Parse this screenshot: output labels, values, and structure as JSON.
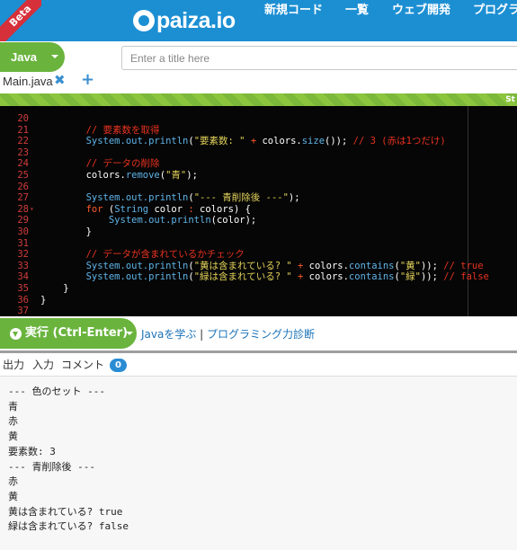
{
  "header": {
    "beta": "Beta",
    "logo_text": "paiza.io",
    "nav": [
      "新規コード",
      "一覧",
      "ウェブ開発",
      "プログラ"
    ]
  },
  "language": {
    "label": "Java"
  },
  "title_input": {
    "value": "",
    "placeholder": "Enter a title here"
  },
  "file_tab": {
    "label": "Main.java",
    "close": "✖",
    "add": "+"
  },
  "stripe_label": "St",
  "editor": {
    "lines": [
      {
        "n": "20",
        "fold": "",
        "tokens": []
      },
      {
        "n": "21",
        "fold": "",
        "tokens": [
          [
            "cm",
            "        // 要素数を取得"
          ]
        ]
      },
      {
        "n": "22",
        "fold": "",
        "tokens": [
          [
            "fld",
            "        System.out.println"
          ],
          [
            "txt",
            "("
          ],
          [
            "str",
            "\"要素数: \""
          ],
          [
            "txt",
            " "
          ],
          [
            "kw",
            "+"
          ],
          [
            "txt",
            " colors."
          ],
          [
            "mth",
            "size"
          ],
          [
            "txt",
            "()); "
          ],
          [
            "cm",
            "// 3 (赤は1つだけ)"
          ]
        ]
      },
      {
        "n": "23",
        "fold": "",
        "tokens": []
      },
      {
        "n": "24",
        "fold": "",
        "tokens": [
          [
            "cm",
            "        // データの削除"
          ]
        ]
      },
      {
        "n": "25",
        "fold": "",
        "tokens": [
          [
            "txt",
            "        colors."
          ],
          [
            "mth",
            "remove"
          ],
          [
            "txt",
            "("
          ],
          [
            "str",
            "\"青\""
          ],
          [
            "txt",
            ");"
          ]
        ]
      },
      {
        "n": "26",
        "fold": "",
        "tokens": []
      },
      {
        "n": "27",
        "fold": "",
        "tokens": [
          [
            "fld",
            "        System.out.println"
          ],
          [
            "txt",
            "("
          ],
          [
            "str",
            "\"--- 青削除後 ---\""
          ],
          [
            "txt",
            ");"
          ]
        ]
      },
      {
        "n": "28",
        "fold": "▾",
        "tokens": [
          [
            "kw",
            "        for"
          ],
          [
            "txt",
            " ("
          ],
          [
            "fld",
            "String"
          ],
          [
            "txt",
            " color "
          ],
          [
            "kw",
            ":"
          ],
          [
            "txt",
            " colors) {"
          ]
        ]
      },
      {
        "n": "29",
        "fold": "",
        "tokens": [
          [
            "fld",
            "            System.out.println"
          ],
          [
            "txt",
            "(color);"
          ]
        ]
      },
      {
        "n": "30",
        "fold": "",
        "tokens": [
          [
            "txt",
            "        }"
          ]
        ]
      },
      {
        "n": "31",
        "fold": "",
        "tokens": []
      },
      {
        "n": "32",
        "fold": "",
        "tokens": [
          [
            "cm",
            "        // データが含まれているかチェック"
          ]
        ]
      },
      {
        "n": "33",
        "fold": "",
        "tokens": [
          [
            "fld",
            "        System.out.println"
          ],
          [
            "txt",
            "("
          ],
          [
            "str",
            "\"黄は含まれている? \""
          ],
          [
            "txt",
            " "
          ],
          [
            "kw",
            "+"
          ],
          [
            "txt",
            " colors."
          ],
          [
            "mth",
            "contains"
          ],
          [
            "txt",
            "("
          ],
          [
            "str",
            "\"黄\""
          ],
          [
            "txt",
            ")); "
          ],
          [
            "cm",
            "// true"
          ]
        ]
      },
      {
        "n": "34",
        "fold": "",
        "tokens": [
          [
            "fld",
            "        System.out.println"
          ],
          [
            "txt",
            "("
          ],
          [
            "str",
            "\"緑は含まれている? \""
          ],
          [
            "txt",
            " "
          ],
          [
            "kw",
            "+"
          ],
          [
            "txt",
            " colors."
          ],
          [
            "mth",
            "contains"
          ],
          [
            "txt",
            "("
          ],
          [
            "str",
            "\"緑\""
          ],
          [
            "txt",
            ")); "
          ],
          [
            "cm",
            "// false"
          ]
        ]
      },
      {
        "n": "35",
        "fold": "",
        "tokens": [
          [
            "txt",
            "    }"
          ]
        ]
      },
      {
        "n": "36",
        "fold": "",
        "tokens": [
          [
            "txt",
            "}"
          ]
        ]
      },
      {
        "n": "37",
        "fold": "",
        "tokens": []
      }
    ]
  },
  "run": {
    "label": "実行 (Ctrl-Enter)",
    "link_learn": "Javaを学ぶ",
    "separator": " | ",
    "link_diagnose": "プログラミング力診断"
  },
  "output_tabs": {
    "output": "出力",
    "input": "入力",
    "comment": "コメント",
    "comment_count": "0"
  },
  "output": {
    "lines": [
      "--- 色のセット ---",
      "青",
      "赤",
      "黄",
      "要素数: 3",
      "--- 青削除後 ---",
      "赤",
      "黄",
      "黄は含まれている? true",
      "緑は含まれている? false"
    ]
  },
  "colors": {
    "header_bg": "#1c8fd3",
    "accent_green": "#6ab43e",
    "beta_red": "#d6303a",
    "editor_bg": "#060606",
    "line_number": "#d23c3c",
    "comment": "#e8321f",
    "string": "#e2d25a",
    "keyword": "#ff5a2c",
    "method": "#5fb4e8",
    "link": "#1c73b8",
    "badge": "#2a8dd4"
  }
}
